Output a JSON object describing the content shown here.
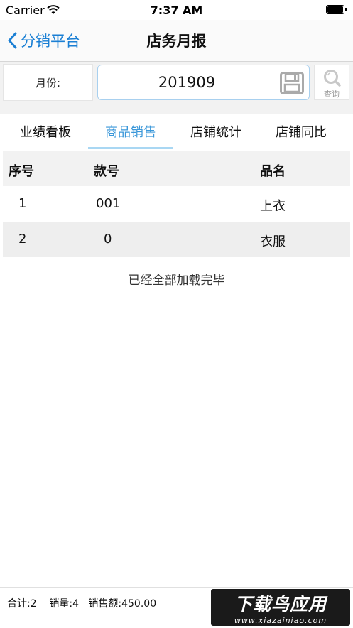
{
  "status_bar": {
    "carrier": "Carrier",
    "time": "7:37 AM"
  },
  "nav": {
    "back_label": "分销平台",
    "title": "店务月报"
  },
  "filter": {
    "month_label": "月份:",
    "month_value": "201909",
    "search_label": "查询"
  },
  "tabs": [
    {
      "label": "业绩看板",
      "active": false
    },
    {
      "label": "商品销售",
      "active": true
    },
    {
      "label": "店铺统计",
      "active": false
    },
    {
      "label": "店铺同比",
      "active": false
    }
  ],
  "table": {
    "columns": [
      "序号",
      "款号",
      "品名"
    ],
    "rows": [
      [
        "1",
        "001",
        "上衣"
      ],
      [
        "2",
        "0",
        "衣服"
      ]
    ]
  },
  "loaded_text": "已经全部加载完毕",
  "footer": {
    "summary": "合计:2    销量:4   销售额:450.00",
    "watermark_main": "下载鸟应用",
    "watermark_sub": "www.xiazainiao.com"
  },
  "colors": {
    "accent": "#1a7fd4",
    "tab_active": "#3a97d9",
    "tab_underline": "#a9d7f3"
  }
}
